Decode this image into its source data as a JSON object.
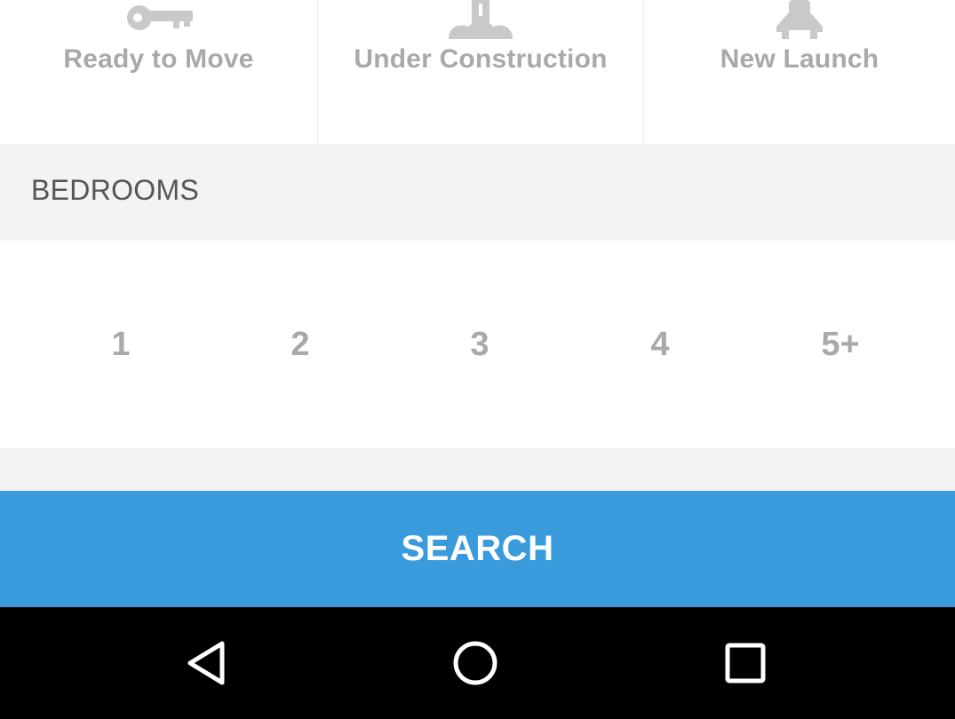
{
  "possession": {
    "options": [
      {
        "label": "Ready to Move",
        "icon": "key-icon"
      },
      {
        "label": "Under Construction",
        "icon": "construction-icon"
      },
      {
        "label": "New Launch",
        "icon": "launch-icon"
      }
    ]
  },
  "bedrooms": {
    "title": "BEDROOMS",
    "options": [
      "1",
      "2",
      "3",
      "4",
      "5+"
    ]
  },
  "search": {
    "label": "SEARCH"
  },
  "nav": {
    "back_icon": "back-triangle-icon",
    "home_icon": "home-circle-icon",
    "recents_icon": "recents-square-icon"
  },
  "colors": {
    "accent": "#3a9bdc",
    "muted_text": "#a9a9a9",
    "section_bg": "#f3f3f3"
  }
}
